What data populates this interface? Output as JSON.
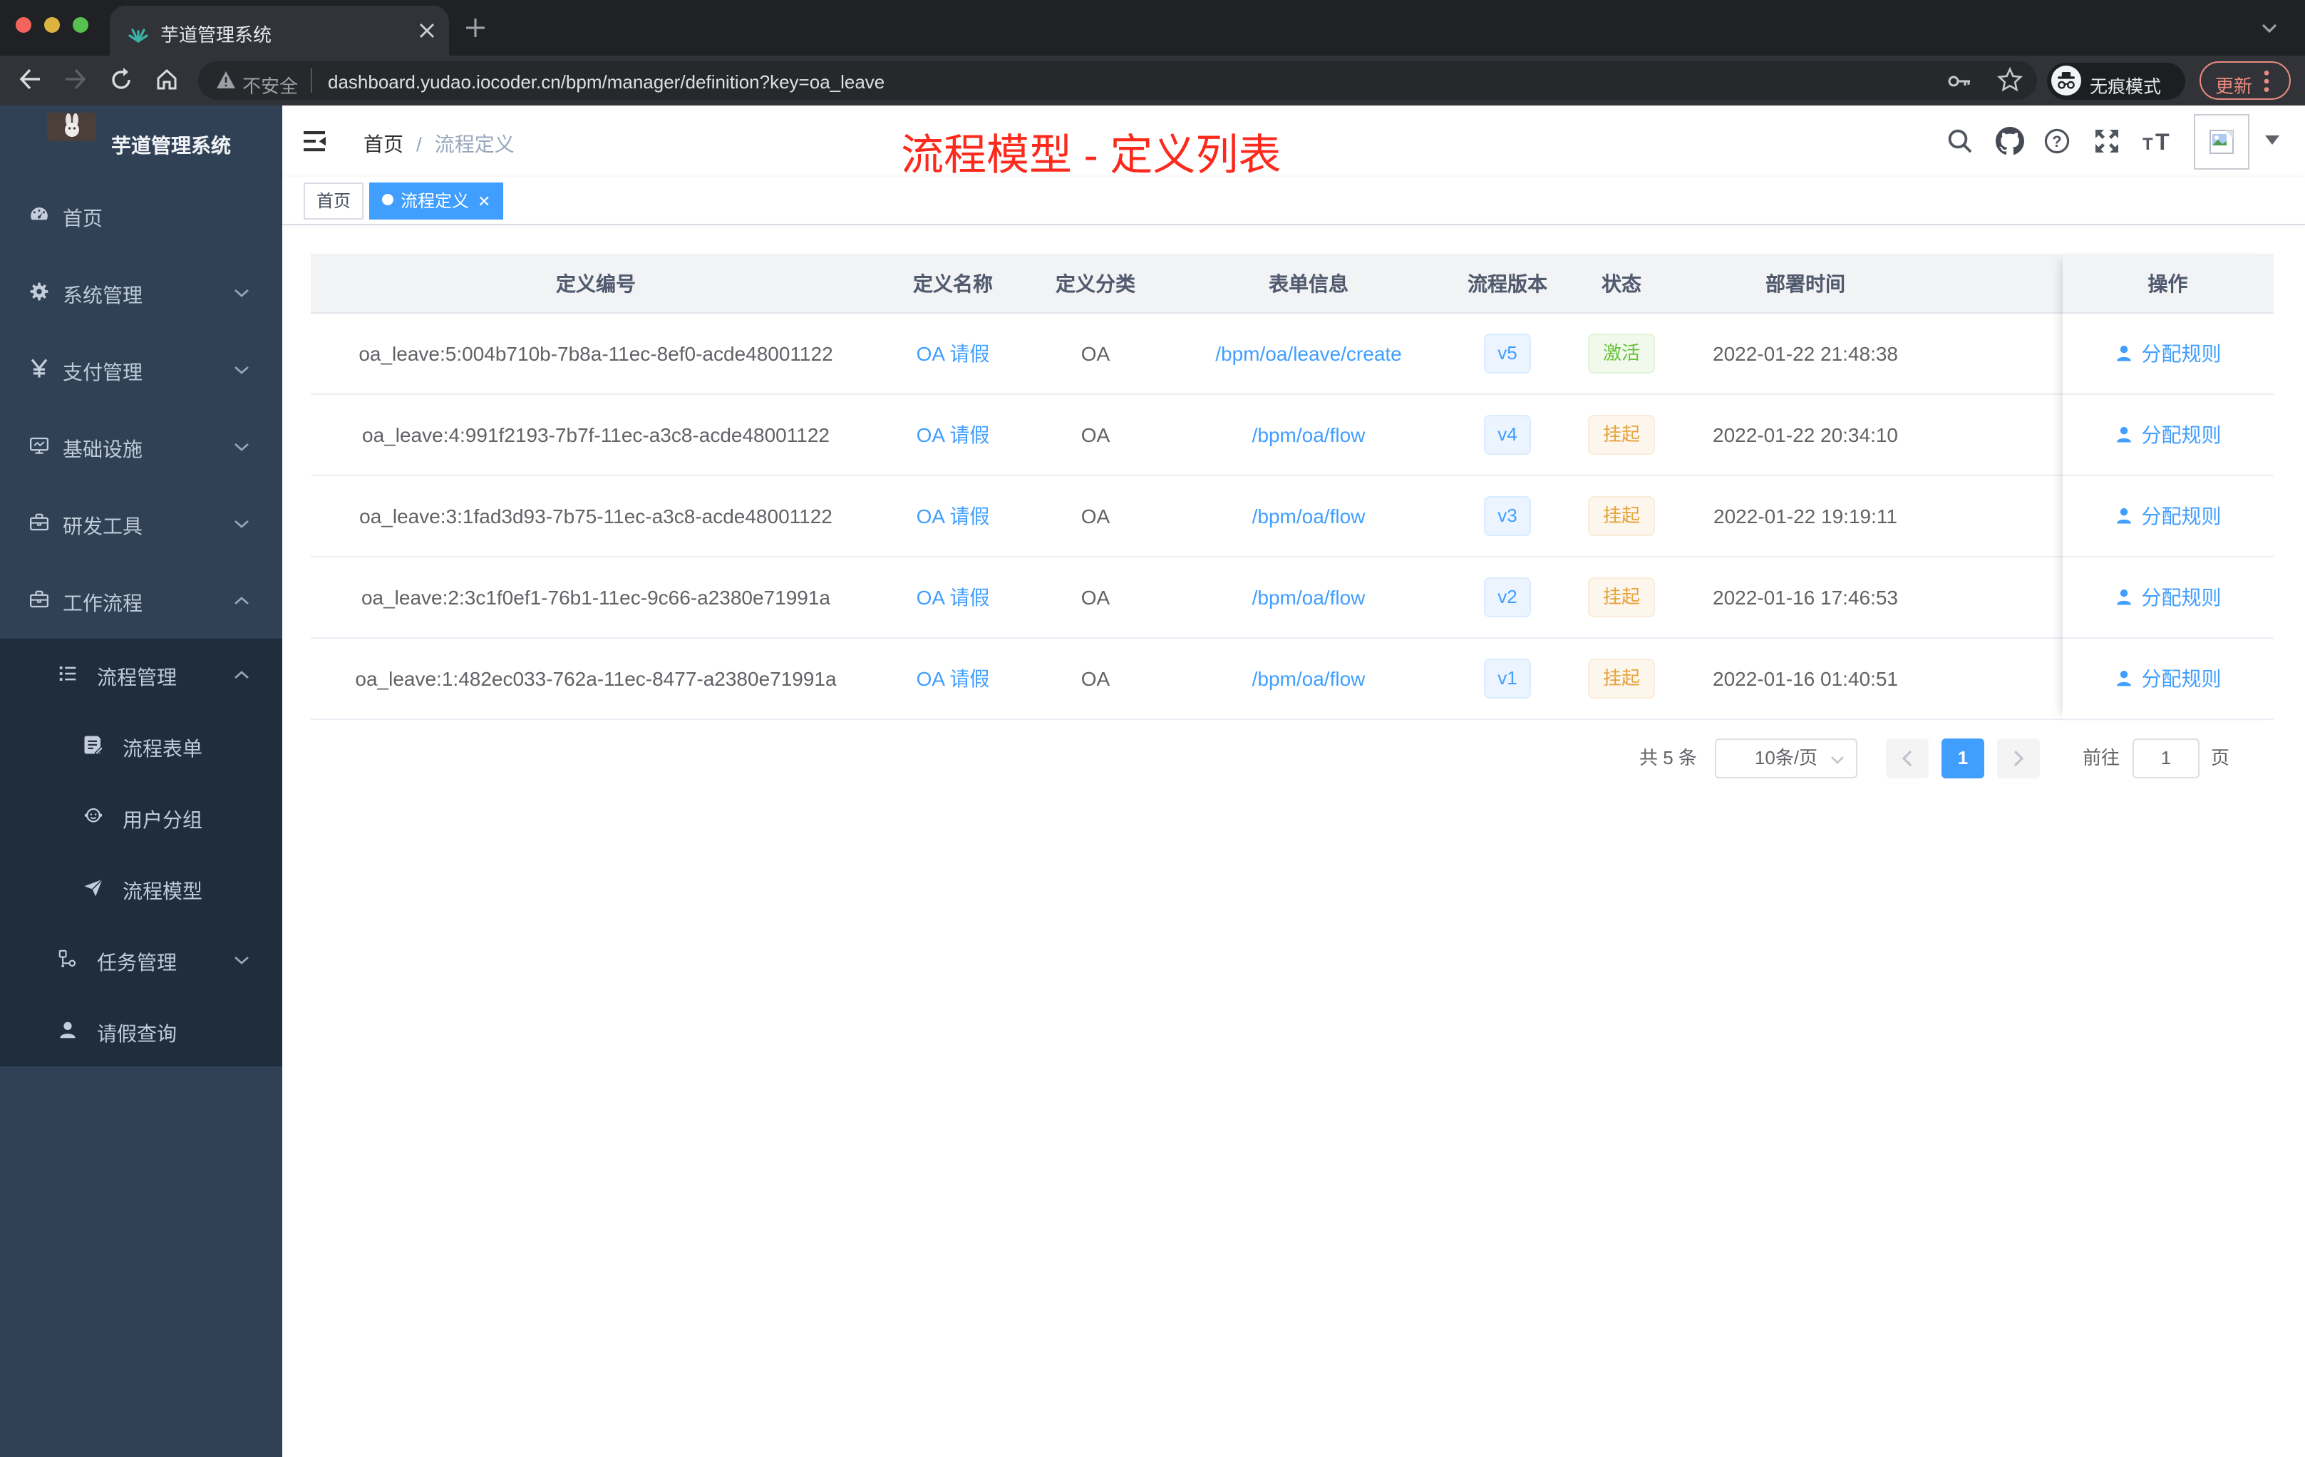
{
  "browser": {
    "tab_title": "芋道管理系统",
    "security_label": "不安全",
    "url": "dashboard.yudao.iocoder.cn/bpm/manager/definition?key=oa_leave",
    "incognito_label": "无痕模式",
    "update_label": "更新"
  },
  "sidebar": {
    "logo_title": "芋道管理系统",
    "items": [
      {
        "label": "首页",
        "icon": "dashboard-icon",
        "level": 1
      },
      {
        "label": "系统管理",
        "icon": "gear-icon",
        "level": 1,
        "expand": "down"
      },
      {
        "label": "支付管理",
        "icon": "yen-icon",
        "level": 1,
        "expand": "down"
      },
      {
        "label": "基础设施",
        "icon": "monitor-icon",
        "level": 1,
        "expand": "down"
      },
      {
        "label": "研发工具",
        "icon": "toolbox-icon",
        "level": 1,
        "expand": "down"
      },
      {
        "label": "工作流程",
        "icon": "briefcase-icon",
        "level": 1,
        "expand": "up"
      },
      {
        "label": "流程管理",
        "icon": "list-icon",
        "level": 2,
        "expand": "up"
      },
      {
        "label": "流程表单",
        "icon": "form-icon",
        "level": 3
      },
      {
        "label": "用户分组",
        "icon": "people-icon",
        "level": 3
      },
      {
        "label": "流程模型",
        "icon": "send-icon",
        "level": 3
      },
      {
        "label": "任务管理",
        "icon": "tree-icon",
        "level": 2,
        "expand": "down"
      },
      {
        "label": "请假查询",
        "icon": "person-icon",
        "level": 2
      }
    ]
  },
  "navbar": {
    "breadcrumb": {
      "first": "首页",
      "sep": "/",
      "last": "流程定义"
    },
    "annotation": "流程模型 - 定义列表"
  },
  "tags": {
    "home": "首页",
    "active": "流程定义"
  },
  "table": {
    "columns": [
      "定义编号",
      "定义名称",
      "定义分类",
      "表单信息",
      "流程版本",
      "状态",
      "部署时间",
      "操作"
    ],
    "rows": [
      {
        "id": "oa_leave:5:004b710b-7b8a-11ec-8ef0-acde48001122",
        "name": "OA 请假",
        "category": "OA",
        "form": "/bpm/oa/leave/create",
        "version": "v5",
        "status": "激活",
        "time": "2022-01-22 21:48:38",
        "op": "分配规则"
      },
      {
        "id": "oa_leave:4:991f2193-7b7f-11ec-a3c8-acde48001122",
        "name": "OA 请假",
        "category": "OA",
        "form": "/bpm/oa/flow",
        "version": "v4",
        "status": "挂起",
        "time": "2022-01-22 20:34:10",
        "op": "分配规则"
      },
      {
        "id": "oa_leave:3:1fad3d93-7b75-11ec-a3c8-acde48001122",
        "name": "OA 请假",
        "category": "OA",
        "form": "/bpm/oa/flow",
        "version": "v3",
        "status": "挂起",
        "time": "2022-01-22 19:19:11",
        "op": "分配规则"
      },
      {
        "id": "oa_leave:2:3c1f0ef1-76b1-11ec-9c66-a2380e71991a",
        "name": "OA 请假",
        "category": "OA",
        "form": "/bpm/oa/flow",
        "version": "v2",
        "status": "挂起",
        "time": "2022-01-16 17:46:53",
        "op": "分配规则"
      },
      {
        "id": "oa_leave:1:482ec033-762a-11ec-8477-a2380e71991a",
        "name": "OA 请假",
        "category": "OA",
        "form": "/bpm/oa/flow",
        "version": "v1",
        "status": "挂起",
        "time": "2022-01-16 01:40:51",
        "op": "分配规则"
      }
    ]
  },
  "pagination": {
    "total": "共 5 条",
    "page_size": "10条/页",
    "current_page": "1",
    "goto_label": "前往",
    "goto_value": "1",
    "unit_label": "页"
  },
  "colors": {
    "accent": "#409eff",
    "success": "#67c23a",
    "warning": "#e6a23c",
    "sidebar_bg": "#304156",
    "submenu_bg": "#1f2d3d",
    "annotation_red": "#fb2a1d"
  }
}
